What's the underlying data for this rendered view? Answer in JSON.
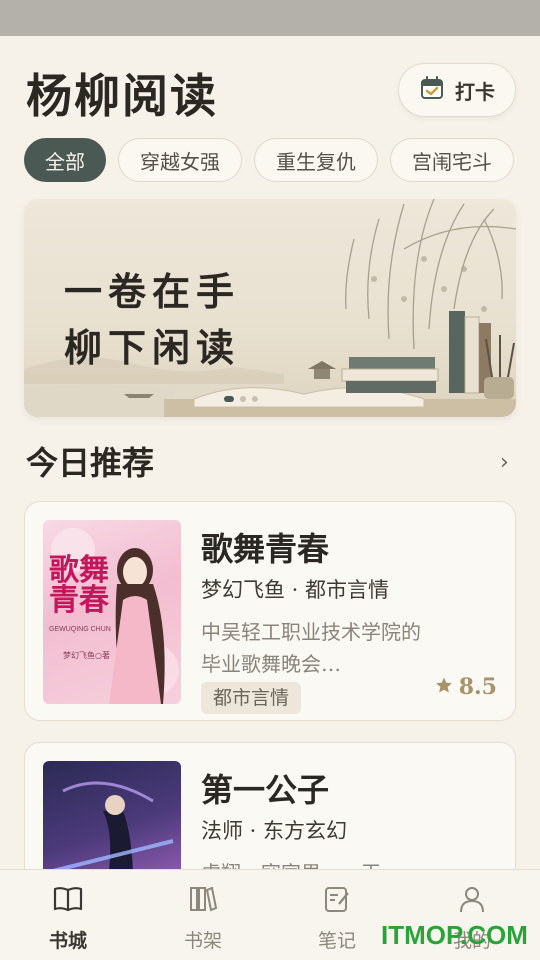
{
  "app": {
    "title": "杨柳阅读"
  },
  "checkin": {
    "label": "打卡",
    "icon": "calendar-check-icon"
  },
  "categories": [
    {
      "label": "全部",
      "active": true
    },
    {
      "label": "穿越女强",
      "active": false
    },
    {
      "label": "重生复仇",
      "active": false
    },
    {
      "label": "宫闱宅斗",
      "active": false
    }
  ],
  "banner": {
    "line1": "一卷在手",
    "line2": "柳下闲读",
    "slides": 3,
    "current": 1
  },
  "section": {
    "title": "今日推荐",
    "arrow": "›"
  },
  "books": [
    {
      "title": "歌舞青春",
      "meta": "梦幻飞鱼 · 都市言情",
      "desc": "中吴轻工职业技术学院的毕业歌舞晚会…",
      "tag": "都市言情",
      "rating": "8.5",
      "cover": {
        "title": "歌舞青春",
        "pinyin": "GEWUQING CHUN",
        "author": "梦幻飞鱼○著"
      }
    },
    {
      "title": "第一公子",
      "meta": "法师 · 东方玄幻",
      "desc": "虎翔，寇家男……王",
      "tag": "",
      "rating": ""
    }
  ],
  "tabs": [
    {
      "label": "书城",
      "icon": "book-open-icon",
      "active": true
    },
    {
      "label": "书架",
      "icon": "bookshelf-icon",
      "active": false
    },
    {
      "label": "笔记",
      "icon": "note-edit-icon",
      "active": false
    },
    {
      "label": "我的",
      "icon": "user-icon",
      "active": false
    }
  ],
  "watermark": "ITMOP.COM",
  "colors": {
    "accent": "#4b5955",
    "background": "#f6f2ea",
    "rating": "#a8926a",
    "watermark": "#2aa43a"
  }
}
